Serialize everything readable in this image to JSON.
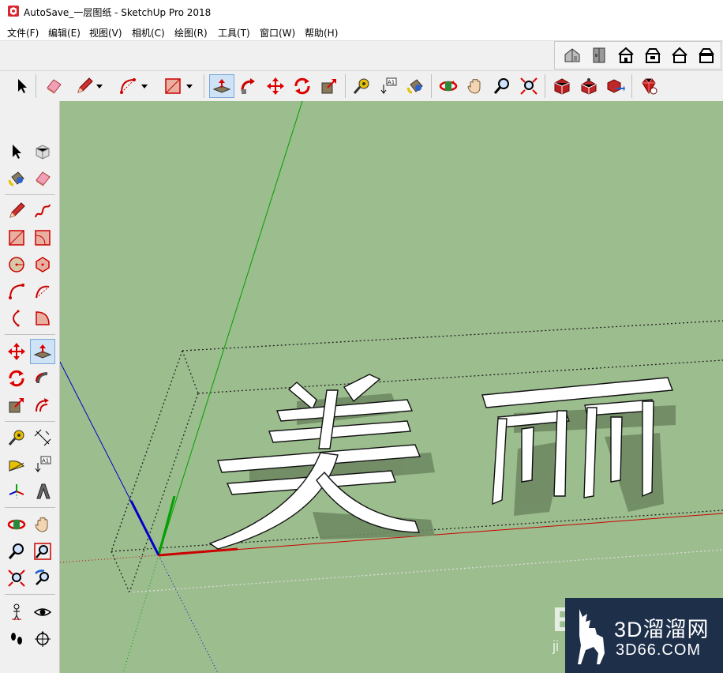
{
  "window": {
    "title": "AutoSave_一层图纸 - SketchUp Pro 2018"
  },
  "menu": [
    "文件(F)",
    "编辑(E)",
    "视图(V)",
    "相机(C)",
    "绘图(R)",
    "工具(T)",
    "窗口(W)",
    "帮助(H)"
  ],
  "model": {
    "text_chars": [
      "美",
      "丽"
    ]
  },
  "colors": {
    "viewport_bg": "#9cbd8e",
    "axis_red": "#cc0000",
    "axis_green": "#00aa00",
    "axis_blue": "#0000cc",
    "active_tool": "#cfe3f7"
  },
  "watermark": {
    "brand": "3D溜溜网",
    "url": "3D66.COM",
    "partial_left": "E",
    "partial_sub": "ji"
  }
}
